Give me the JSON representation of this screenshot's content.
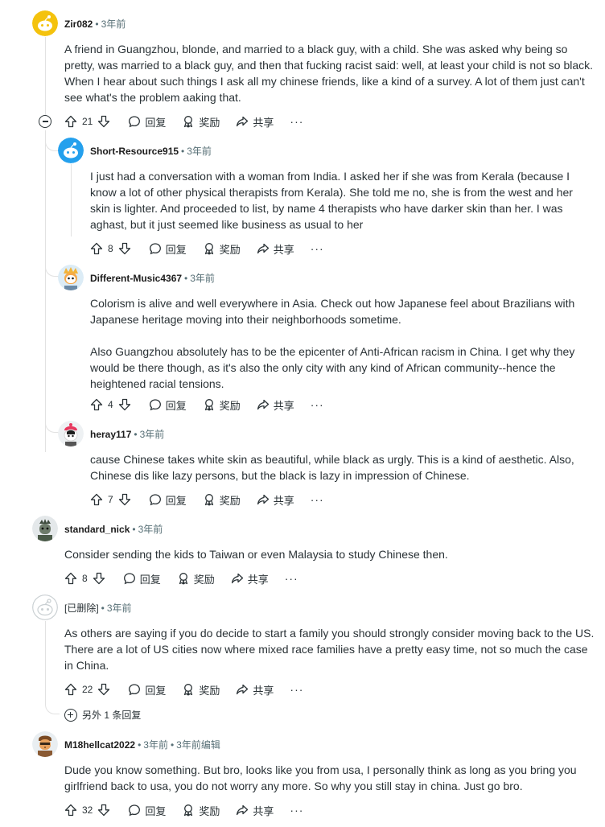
{
  "actions": {
    "reply": "回复",
    "award": "奖励",
    "share": "共享",
    "more": "···"
  },
  "comments": [
    {
      "author": "Zir082",
      "time": "3年前",
      "votes": "21",
      "body": [
        "A friend in Guangzhou, blonde, and married to a black guy, with a child. She was asked why being so pretty, was married to a black guy, and then that fucking racist said: well, at least your child is not so black. When I hear about such things I ask all my chinese friends, like a kind of a survey. A lot of them just can't see what's the problem aaking that."
      ]
    },
    {
      "author": "Short-Resource915",
      "time": "3年前",
      "votes": "8",
      "body": [
        "I just had a conversation with a woman from India. I asked her if she was from Kerala (because I know a lot of other physical therapists from Kerala). She told me no, she is from the west and her skin is lighter. And proceeded to list, by name 4 therapists who have darker skin than her. I was aghast, but it just seemed like business as usual to her"
      ]
    },
    {
      "author": "Different-Music4367",
      "time": "3年前",
      "votes": "4",
      "body": [
        "Colorism is alive and well everywhere in Asia. Check out how Japanese feel about Brazilians with Japanese heritage moving into their neighborhoods sometime.",
        "Also Guangzhou absolutely has to be the epicenter of Anti-African racism in China. I get why they would be there though, as it's also the only city with any kind of African community--hence the heightened racial tensions."
      ]
    },
    {
      "author": "heray117",
      "time": "3年前",
      "votes": "7",
      "body": [
        "cause Chinese takes white skin as beautiful, while black as urgly. This is a kind of aesthetic. Also, Chinese dis like lazy persons, but the black is lazy in impression of Chinese."
      ]
    },
    {
      "author": "standard_nick",
      "time": "3年前",
      "votes": "8",
      "body": [
        "Consider sending the kids to Taiwan or even Malaysia to study Chinese then."
      ]
    },
    {
      "author": "[已删除]",
      "time": "3年前",
      "votes": "22",
      "body": [
        "As others are saying if you do decide to start a family you should strongly consider moving back to the US. There are a lot of US cities now where mixed race families have a pretty easy time, not so much the case in China."
      ],
      "more_replies": "另外 1 条回复"
    },
    {
      "author": "M18hellcat2022",
      "time": "3年前",
      "edited": "3年前编辑",
      "votes": "32",
      "body": [
        "Dude you know something. But bro, looks like you from usa, I personally think as long as you bring you girlfriend back to usa, you do not worry any more. So why you still stay in china. Just go bro."
      ]
    }
  ],
  "colors": {
    "text": "#2a3236",
    "meta": "#576f76",
    "thread_line": "#e2e2e2"
  },
  "icons": [
    "upvote-icon",
    "downvote-icon",
    "reply-icon",
    "award-icon",
    "share-icon",
    "collapse-icon",
    "expand-icon"
  ]
}
